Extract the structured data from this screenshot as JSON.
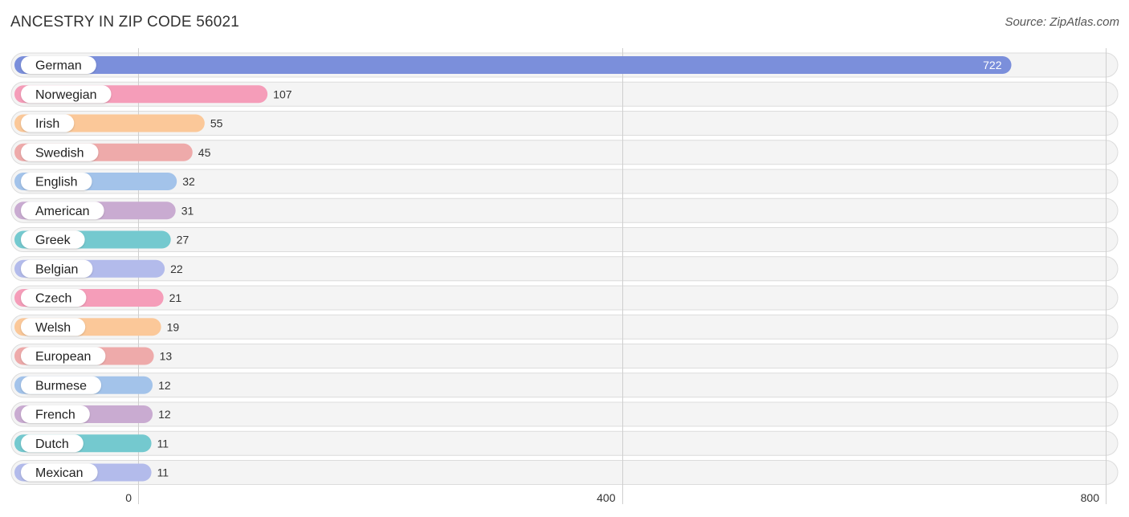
{
  "header": {
    "title": "ANCESTRY IN ZIP CODE 56021",
    "source": "Source: ZipAtlas.com"
  },
  "chart_data": {
    "type": "bar",
    "orientation": "horizontal",
    "title": "ANCESTRY IN ZIP CODE 56021",
    "xlabel": "",
    "ylabel": "",
    "xlim": [
      0,
      800
    ],
    "ticks": [
      0,
      400,
      800
    ],
    "tick_labels": [
      "0",
      "400",
      "800"
    ],
    "grid": true,
    "categories": [
      "German",
      "Norwegian",
      "Irish",
      "Swedish",
      "English",
      "American",
      "Greek",
      "Belgian",
      "Czech",
      "Welsh",
      "European",
      "Burmese",
      "French",
      "Dutch",
      "Mexican"
    ],
    "values": [
      722,
      107,
      55,
      45,
      32,
      31,
      27,
      22,
      21,
      19,
      13,
      12,
      12,
      11,
      11
    ],
    "colors": [
      "#7b8fdb",
      "#f59db9",
      "#fbc899",
      "#eeaaaa",
      "#a3c3ea",
      "#c9abd1",
      "#74c9cf",
      "#b3bbeb",
      "#f59db9",
      "#fbc899",
      "#eeaaaa",
      "#a3c3ea",
      "#c9abd1",
      "#74c9cf",
      "#b3bbeb"
    ]
  }
}
